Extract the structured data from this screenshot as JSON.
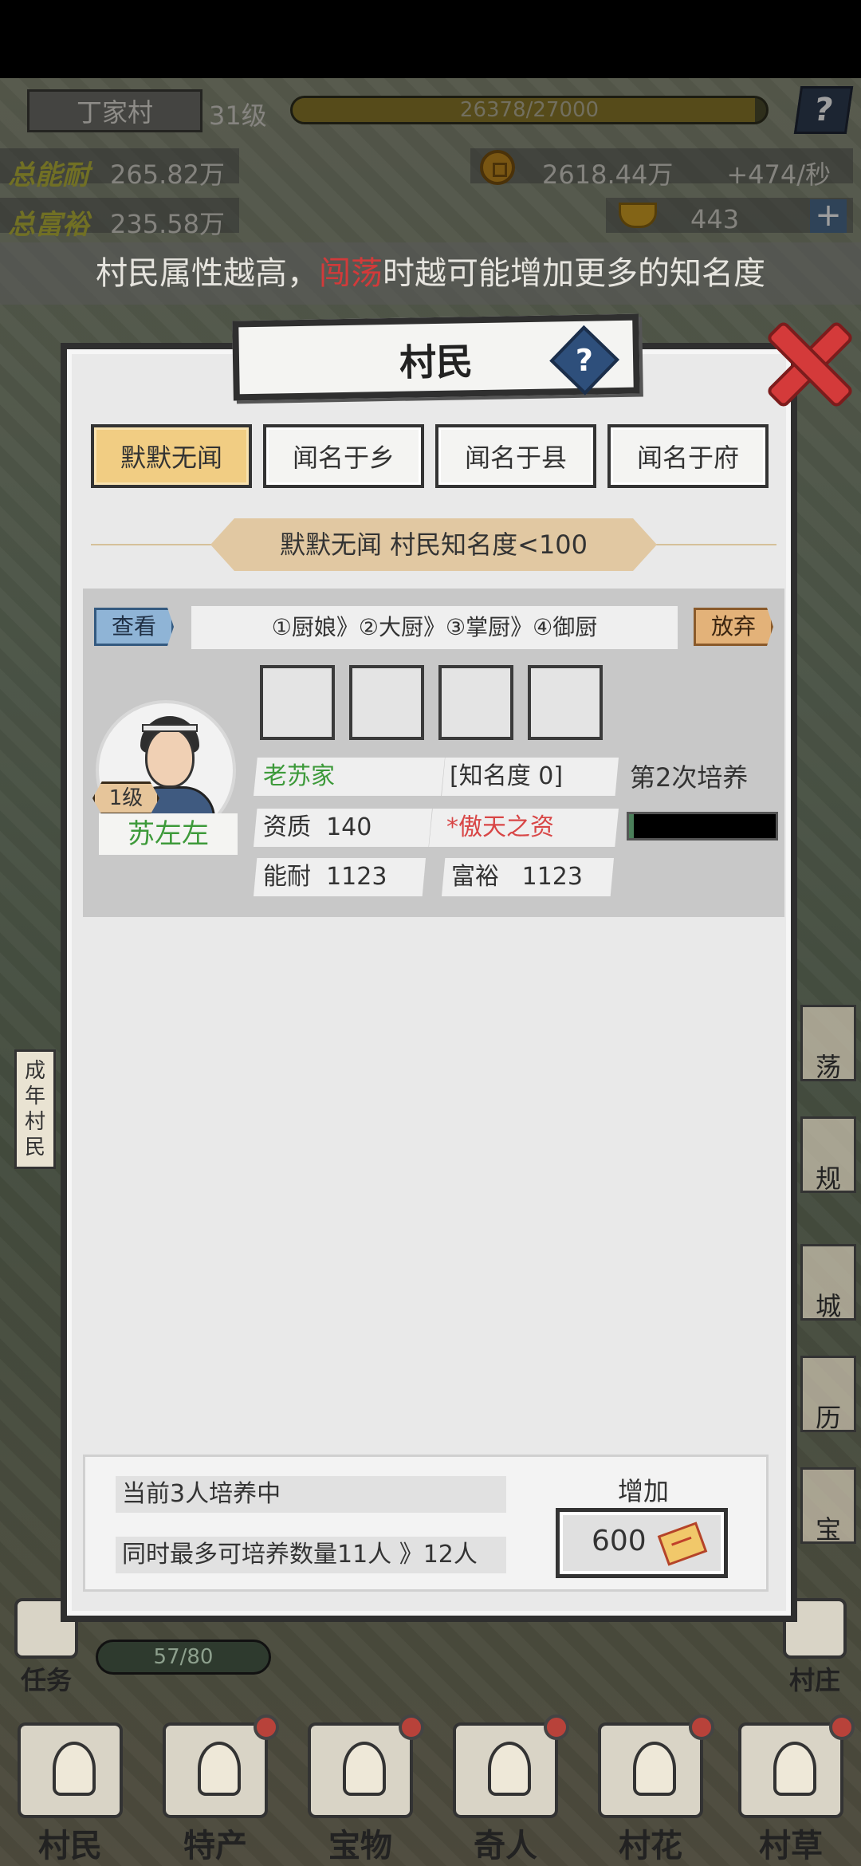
{
  "hud": {
    "village_name": "丁家村",
    "village_level": "31级",
    "exp_text": "26378/27000",
    "exp_fraction": 0.977,
    "help_icon": "?",
    "stat_power_label": "总能耐",
    "stat_power_value": "265.82万",
    "stat_wealth_label": "总富裕",
    "stat_wealth_value": "235.58万",
    "coins": "2618.44万",
    "coin_rate": "+474/秒",
    "ingots": "443",
    "plus_icon": "+"
  },
  "tip": {
    "before": "村民属性越高，",
    "highlight": "闯荡",
    "after": "时越可能增加更多的知名度"
  },
  "modal": {
    "title": "村民",
    "help_icon": "?",
    "tabs": [
      "默默无闻",
      "闻名于乡",
      "闻名于县",
      "闻名于府"
    ],
    "active_tab": 0,
    "rank_banner": "默默无闻  村民知名度<100",
    "card": {
      "view_label": "查看",
      "career_path": "①厨娘》②大厨》③掌厨》④御厨",
      "abandon_label": "放弃",
      "level": "1级",
      "name": "苏左左",
      "family": "老苏家",
      "fame": "[知名度 0]",
      "train_count": "第2次培养",
      "aptitude_label": "资质",
      "aptitude_value": "140",
      "talent": "*傲天之资",
      "power_label": "能耐",
      "power_value": "1123",
      "wealth_label": "富裕",
      "wealth_value": "1123",
      "train_progress": 0.03
    },
    "bottom": {
      "current_training": "当前3人培养中",
      "max_training": "同时最多可培养数量11人 》12人",
      "add_label": "增加",
      "add_cost": "600"
    }
  },
  "background": {
    "side_label": "成年村民",
    "right_buttons": [
      "荡",
      "规",
      "城",
      "历",
      "宝"
    ],
    "task_label": "任务",
    "task_progress": "57/80",
    "village_house_label": "村庄"
  },
  "bottom_nav": [
    {
      "label": "村民",
      "badge": false
    },
    {
      "label": "特产",
      "badge": true
    },
    {
      "label": "宝物",
      "badge": true
    },
    {
      "label": "奇人",
      "badge": true
    },
    {
      "label": "村花",
      "badge": true
    },
    {
      "label": "村草",
      "badge": true
    }
  ],
  "colors": {
    "active_tab": "#f1cd83",
    "green_text": "#3d9a3a",
    "red_text": "#d84646",
    "close_red": "#d43a3a",
    "help_blue": "#2e4f7b"
  }
}
